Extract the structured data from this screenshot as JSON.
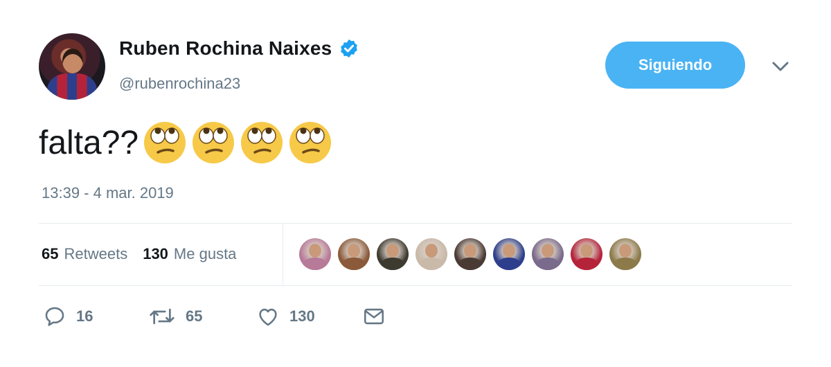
{
  "author": {
    "display_name": "Ruben Rochina Naixes",
    "handle": "@rubenrochina23",
    "verified": true
  },
  "follow_button": {
    "label": "Siguiendo"
  },
  "tweet": {
    "text": "falta??",
    "emojis": [
      "face-with-rolling-eyes",
      "face-with-rolling-eyes",
      "face-with-rolling-eyes",
      "face-with-rolling-eyes"
    ],
    "timestamp": "13:39 - 4 mar. 2019"
  },
  "stats": {
    "retweets_count": "65",
    "retweets_label": "Retweets",
    "likes_count": "130",
    "likes_label": "Me gusta"
  },
  "likers": [
    {
      "tone": "#b77a98"
    },
    {
      "tone": "#8a5a3a"
    },
    {
      "tone": "#3d3a30"
    },
    {
      "tone": "#c9b9a8"
    },
    {
      "tone": "#4a3a34"
    },
    {
      "tone": "#2d3f8c"
    },
    {
      "tone": "#7a6a8c"
    },
    {
      "tone": "#b5233a"
    },
    {
      "tone": "#8c7a4a"
    }
  ],
  "actions": {
    "reply_count": "16",
    "retweet_count": "65",
    "like_count": "130"
  },
  "colors": {
    "accent": "#4ab3f4",
    "verified": "#1da1f2",
    "muted": "#657786",
    "text": "#14171a",
    "divider": "#e6ecf0"
  }
}
